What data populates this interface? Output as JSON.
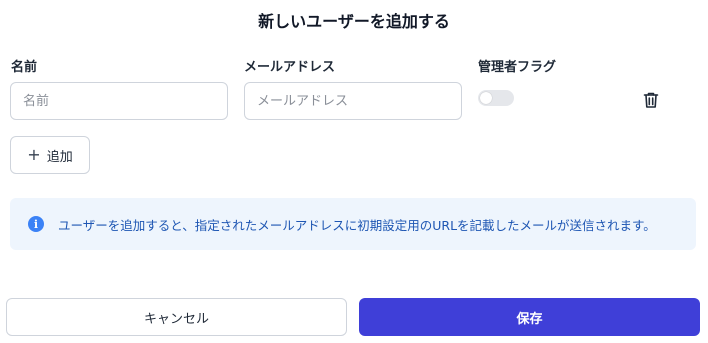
{
  "dialog": {
    "title": "新しいユーザーを追加する"
  },
  "columns": {
    "name": "名前",
    "email": "メールアドレス",
    "admin": "管理者フラグ"
  },
  "row": {
    "name_value": "",
    "name_placeholder": "名前",
    "email_value": "",
    "email_placeholder": "メールアドレス",
    "admin_on": false
  },
  "add_button": {
    "icon": "plus-icon",
    "label": "追加"
  },
  "info": {
    "icon": "info-icon",
    "text": "ユーザーを追加すると、指定されたメールアドレスに初期設定用のURLを記載したメールが送信されます。"
  },
  "footer": {
    "cancel_label": "キャンセル",
    "save_label": "保存"
  },
  "colors": {
    "primary": "#3f3fd8",
    "info_bg": "#eef5fd",
    "info_text": "#1e56b3"
  }
}
